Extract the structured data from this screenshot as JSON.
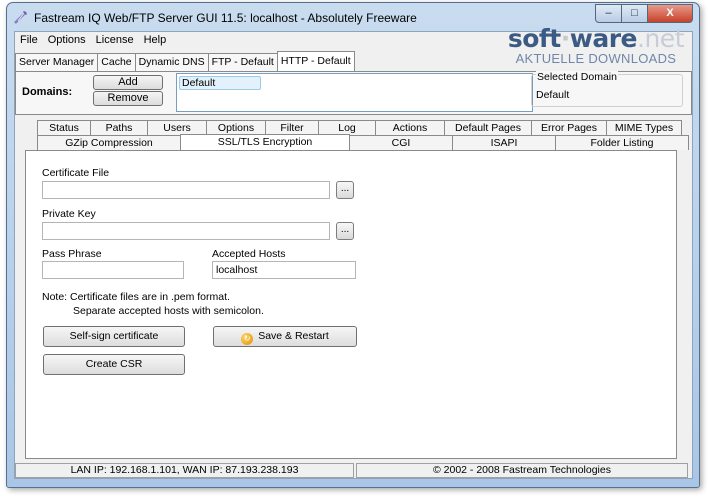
{
  "window": {
    "title": "Fastream IQ Web/FTP Server GUI 11.5: localhost - Absolutely Freeware",
    "minimize": "–",
    "maximize": "□",
    "close": "X"
  },
  "menu": [
    "File",
    "Options",
    "License",
    "Help"
  ],
  "watermark": {
    "logo_a": "soft",
    "logo_dot": "·",
    "logo_b": "ware",
    "logo_net": ".net",
    "tagline": "AKTUELLE DOWNLOADS"
  },
  "server_tabs": [
    "Server Manager",
    "Cache",
    "Dynamic DNS",
    "FTP - Default",
    "HTTP - Default"
  ],
  "domains": {
    "label": "Domains:",
    "add": "Add",
    "remove": "Remove",
    "list": [
      "Default"
    ],
    "selected_title": "Selected Domain",
    "selected_value": "Default"
  },
  "tabs_row1": [
    "Status",
    "Paths",
    "Users",
    "Options",
    "Filter",
    "Log",
    "Actions",
    "Default Pages",
    "Error Pages",
    "MIME Types"
  ],
  "tabs_row2": [
    "GZip Compression",
    "SSL/TLS Encryption",
    "CGI",
    "ISAPI",
    "Folder Listing"
  ],
  "ssl": {
    "cert_label": "Certificate File",
    "cert_value": "",
    "key_label": "Private Key",
    "key_value": "",
    "browse": "...",
    "pass_label": "Pass Phrase",
    "pass_value": "",
    "hosts_label": "Accepted Hosts",
    "hosts_value": "localhost",
    "note_line1": "Note: Certificate files are in .pem format.",
    "note_line2": "Separate accepted hosts with semicolon.",
    "self_sign": "Self-sign certificate",
    "save_restart": "Save & Restart",
    "create_csr": "Create CSR"
  },
  "status": {
    "network": "LAN IP: 192.168.1.101, WAN IP: 87.193.238.193",
    "copyright": "© 2002 - 2008 Fastream Technologies"
  }
}
